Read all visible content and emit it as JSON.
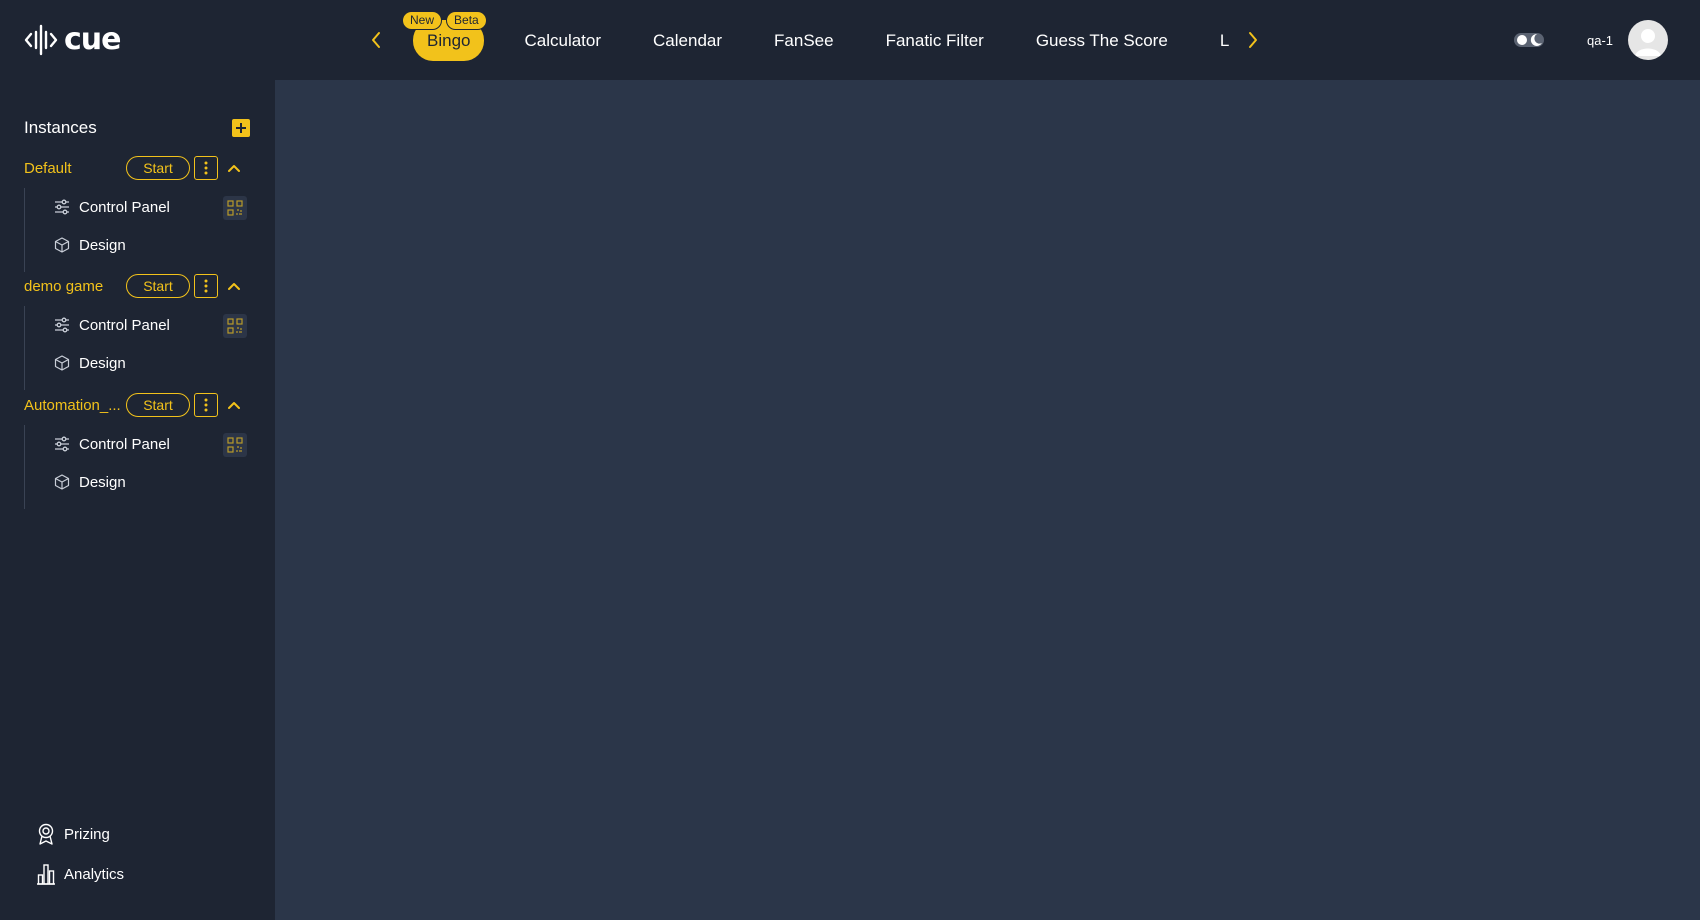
{
  "app": {
    "logo_text": "cue"
  },
  "topbar": {
    "tabs": [
      {
        "label": "Bingo",
        "badges": [
          "New",
          "Beta"
        ],
        "active": true
      },
      {
        "label": "Calculator"
      },
      {
        "label": "Calendar"
      },
      {
        "label": "FanSee"
      },
      {
        "label": "Fanatic Filter"
      },
      {
        "label": "Guess The Score"
      },
      {
        "label": "Lig"
      }
    ],
    "username": "qa-1"
  },
  "sidebar": {
    "title": "Instances",
    "groups": [
      {
        "name": "Default",
        "start_label": "Start",
        "children": [
          {
            "label": "Control Panel",
            "icon": "sliders-icon"
          },
          {
            "label": "Design",
            "icon": "cube-icon"
          }
        ]
      },
      {
        "name": "demo game",
        "start_label": "Start",
        "children": [
          {
            "label": "Control Panel",
            "icon": "sliders-icon"
          },
          {
            "label": "Design",
            "icon": "cube-icon"
          }
        ]
      },
      {
        "name": "Automation_...",
        "start_label": "Start",
        "children": [
          {
            "label": "Control Panel",
            "icon": "sliders-icon"
          },
          {
            "label": "Design",
            "icon": "cube-icon"
          }
        ]
      }
    ],
    "bottom_nav": [
      {
        "label": "Prizing",
        "icon": "award-icon"
      },
      {
        "label": "Analytics",
        "icon": "bar-chart-icon"
      }
    ]
  },
  "theme": {
    "accent": "#f2c21b",
    "bg": "#1e2533",
    "panel": "#2b3649"
  }
}
